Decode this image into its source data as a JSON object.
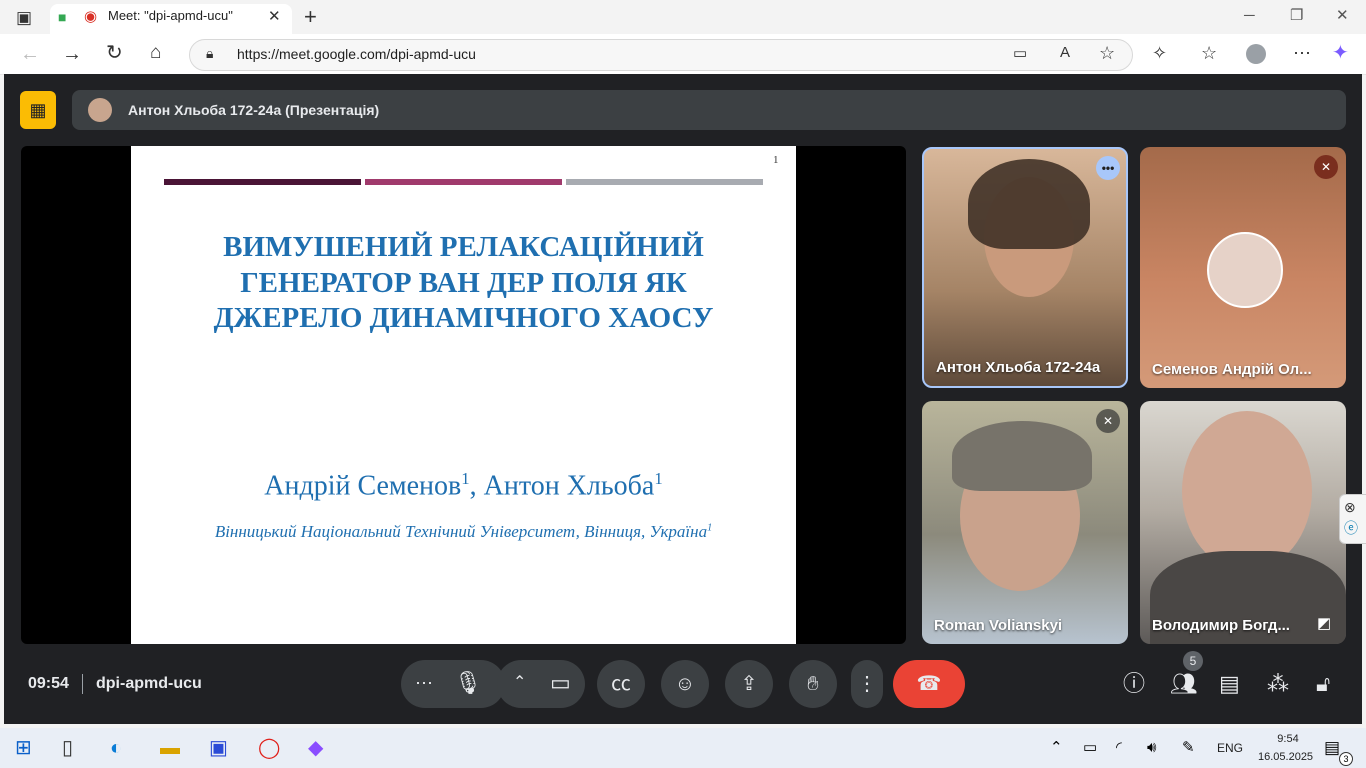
{
  "browser": {
    "tab_title": "Meet: \"dpi-apmd-ucu\"",
    "new_tab": "+",
    "url": "https://meet.google.com/dpi-apmd-ucu"
  },
  "meet": {
    "presenter_label": "Антон Хльоба 172-24а (Презентація)",
    "slide": {
      "number": "1",
      "title_lines": [
        "ВИМУШЕНИЙ РЕЛАКСАЦІЙНИЙ",
        "ГЕНЕРАТОР ВАН ДЕР ПОЛЯ ЯК",
        "ДЖЕРЕЛО ДИНАМІЧНОГО ХАОСУ"
      ],
      "author1": "Андрій Семенов",
      "author_sep": ", ",
      "author2": "Антон Хльоба",
      "sup": "1",
      "affiliation": "Вінницький Національний Технічний Університет, Вінниця, Україна",
      "bar_colors": [
        "#4a1436",
        "#a03a6c",
        "#a8abb1"
      ]
    },
    "participants": [
      {
        "name": "Антон Хльоба 172-24а",
        "state": "more-options"
      },
      {
        "name": "Семенов Андрій Ол...",
        "state": "muted"
      },
      {
        "name": "Roman Volianskyi",
        "state": "muted"
      },
      {
        "name": "Володимир Богд...",
        "state": "pinned"
      }
    ],
    "time": "09:54",
    "meeting_code": "dpi-apmd-ucu",
    "people_count": "5",
    "colors": {
      "end_call": "#ea4335",
      "presenting": "#fbbc04",
      "active_border": "#a8c7fa"
    }
  },
  "taskbar": {
    "lang": "ENG",
    "time": "9:54",
    "date": "16.05.2025",
    "notifications": "3"
  }
}
